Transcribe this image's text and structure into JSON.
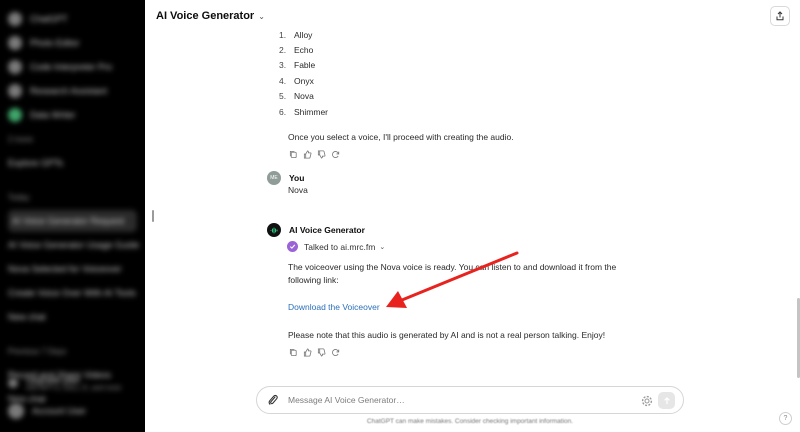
{
  "sidebar": {
    "items": [
      {
        "label": "ChatGPT",
        "icon": "app-logo-icon"
      },
      {
        "label": "Photo Editor",
        "icon": "gpt-icon"
      },
      {
        "label": "Code Interpreter Pro",
        "icon": "gpt-icon"
      },
      {
        "label": "Research Assistant",
        "icon": "gpt-icon"
      },
      {
        "label": "Data Writer",
        "icon": "gpt-icon"
      }
    ],
    "more_label": "2 more",
    "explore_label": "Explore GPTs",
    "section_today": "Today",
    "chats_today": [
      "AI Voice Generator Request",
      "AI Voice Generator Usage Guide",
      "Nova Selected for Voiceover",
      "Create Voice Over With AI Tools",
      "New chat"
    ],
    "section_previous": "Previous 7 Days",
    "chats_previous": [
      "Record and Share Videos",
      "New chat"
    ],
    "upgrade_label": "Upgrade plan",
    "upgrade_sub": "Get GPT-4, DALL·E, and more",
    "user_name": "Account User"
  },
  "header": {
    "title": "AI Voice Generator",
    "chevron": "⌄"
  },
  "voice_list": [
    {
      "num": "1.",
      "name": "Alloy"
    },
    {
      "num": "2.",
      "name": "Echo"
    },
    {
      "num": "3.",
      "name": "Fable"
    },
    {
      "num": "4.",
      "name": "Onyx"
    },
    {
      "num": "5.",
      "name": "Nova"
    },
    {
      "num": "6.",
      "name": "Shimmer"
    }
  ],
  "messages": {
    "assistant_followup": "Once you select a voice, I'll proceed with creating the audio.",
    "user": {
      "avatar_initials": "ME",
      "author": "You",
      "text": "Nova"
    },
    "assistant": {
      "author": "AI Voice Generator",
      "talked_to": "Talked to ai.mrc.fm",
      "line1": "The voiceover using the Nova voice is ready. You can listen to and download it from the",
      "line2": "following link:",
      "link_text": "Download the Voiceover",
      "note": "Please note that this audio is generated by AI and is not a real person talking. Enjoy!"
    }
  },
  "composer": {
    "placeholder": "Message AI Voice Generator…"
  },
  "disclaimer": "ChatGPT can make mistakes. Consider checking important information.",
  "help_label": "?",
  "colors": {
    "sidebar_bg": "#000000",
    "link": "#2b6fb8",
    "arrow": "#e8231f",
    "plugin_check": "#9a63d6"
  }
}
